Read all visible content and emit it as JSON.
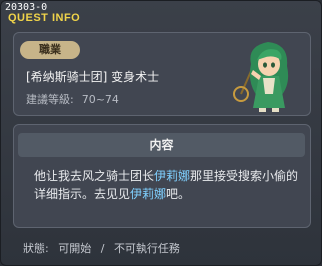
{
  "header": {
    "quest_id": "20303-0",
    "title": "QUEST INFO"
  },
  "job": {
    "badge_label": "職業",
    "name": "[希纳斯骑士团] 变身术士",
    "level_label": "建議等級:",
    "level_range": "70~74"
  },
  "content": {
    "header_label": "内容",
    "segments": [
      {
        "text": "他让我去风之骑士团长",
        "highlight": false
      },
      {
        "text": "伊莉娜",
        "highlight": true
      },
      {
        "text": "那里接受搜索小偷的详细指示。去见见",
        "highlight": false
      },
      {
        "text": "伊莉娜",
        "highlight": true
      },
      {
        "text": "吧。",
        "highlight": false
      }
    ]
  },
  "status": {
    "label": "狀態:",
    "value1": "可開始",
    "separator": "/",
    "value2": "不可執行任務"
  },
  "colors": {
    "title": "#f0d44a",
    "highlight": "#7fd0ff",
    "badge": "#c7b489"
  }
}
